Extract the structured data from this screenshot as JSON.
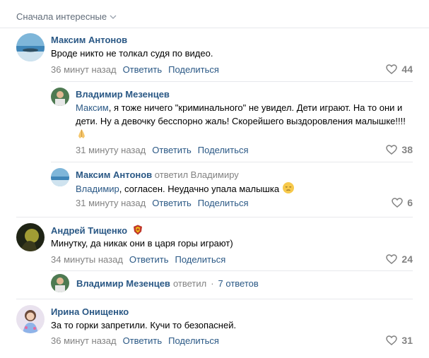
{
  "sort": {
    "label": "Сначала интересные"
  },
  "comments": [
    {
      "author": "Максим Антонов",
      "text": "Вроде никто не толкал судя по видео.",
      "time": "36 минут назад",
      "reply": "Ответить",
      "share": "Поделиться",
      "likes": "44"
    },
    {
      "author": "Владимир Мезенцев",
      "mention": "Максим",
      "text": ", я тоже ничего \"криминального\" не увидел. Дети играют. На то они и дети. Ну а девочку бесспорно жаль! Скорейшего выздоровления малышке!!!!",
      "emoji": "pray-emoji",
      "time": "31 минуту назад",
      "reply": "Ответить",
      "share": "Поделиться",
      "likes": "38"
    },
    {
      "author": "Максим Антонов",
      "reply_to": "ответил Владимиру",
      "mention": "Владимир",
      "text": ", согласен. Неудачно упала малышка",
      "emoji": "pensive-face-emoji",
      "time": "31 минуту назад",
      "reply": "Ответить",
      "share": "Поделиться",
      "likes": "6"
    },
    {
      "author": "Андрей Тищенко",
      "badge": "club-emblem-icon",
      "text": "Минутку, да никак они в царя горы играют)",
      "time": "34 минуты назад",
      "reply": "Ответить",
      "share": "Поделиться",
      "likes": "24"
    },
    {
      "author": "Ирина Онищенко",
      "text": "За то горки запретили. Кучи то безопасней.",
      "time": "36 минут назад",
      "reply": "Ответить",
      "share": "Поделиться",
      "likes": "31"
    }
  ],
  "replies_summary": {
    "author": "Владимир Мезенцев",
    "action": "ответил",
    "count": "7 ответов"
  },
  "colors": {
    "link": "#2a5885",
    "muted": "#828282",
    "divider": "#e7e8ec"
  }
}
